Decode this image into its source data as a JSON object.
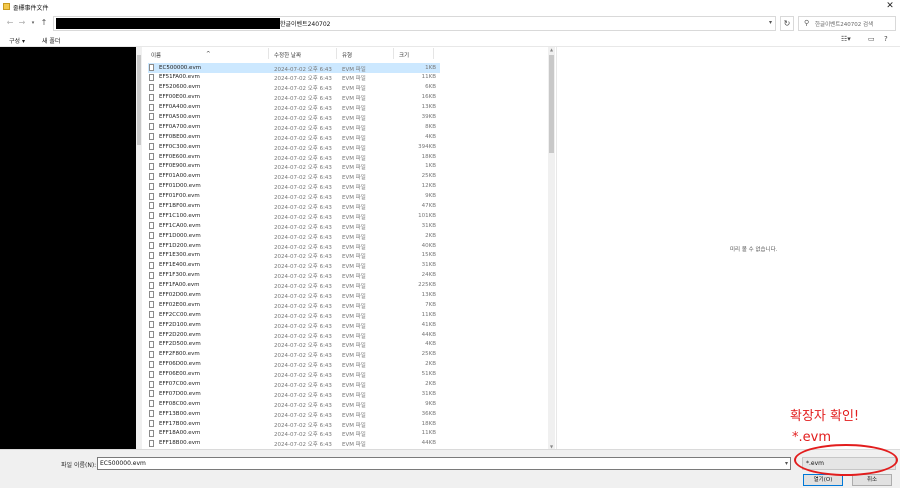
{
  "window": {
    "title": "줄標事件文件"
  },
  "address": {
    "current_folder": "한글이벤트240702",
    "chevron": "›",
    "dropdown": "▾"
  },
  "search": {
    "placeholder": "한글이벤트240702 검색"
  },
  "toolbar": {
    "organize": "구성 ▾",
    "new_folder": "새 폴더"
  },
  "columns": {
    "name": "이름",
    "date": "수정한 날짜",
    "type": "유형",
    "size": "크기"
  },
  "files": [
    {
      "name": "EC500000.evm",
      "date": "2024-07-02 오후 6:43",
      "type": "EVM 파일",
      "size": "1KB"
    },
    {
      "name": "EF51FA00.evm",
      "date": "2024-07-02 오후 6:43",
      "type": "EVM 파일",
      "size": "11KB"
    },
    {
      "name": "EF520600.evm",
      "date": "2024-07-02 오후 6:43",
      "type": "EVM 파일",
      "size": "6KB"
    },
    {
      "name": "EFF00E00.evm",
      "date": "2024-07-02 오후 6:43",
      "type": "EVM 파일",
      "size": "16KB"
    },
    {
      "name": "EFF0A400.evm",
      "date": "2024-07-02 오후 6:43",
      "type": "EVM 파일",
      "size": "13KB"
    },
    {
      "name": "EFF0A500.evm",
      "date": "2024-07-02 오후 6:43",
      "type": "EVM 파일",
      "size": "39KB"
    },
    {
      "name": "EFF0A700.evm",
      "date": "2024-07-02 오후 6:43",
      "type": "EVM 파일",
      "size": "8KB"
    },
    {
      "name": "EFF0BE00.evm",
      "date": "2024-07-02 오후 6:43",
      "type": "EVM 파일",
      "size": "4KB"
    },
    {
      "name": "EFF0C300.evm",
      "date": "2024-07-02 오후 6:43",
      "type": "EVM 파일",
      "size": "394KB"
    },
    {
      "name": "EFF0E600.evm",
      "date": "2024-07-02 오후 6:43",
      "type": "EVM 파일",
      "size": "18KB"
    },
    {
      "name": "EFF0E900.evm",
      "date": "2024-07-02 오후 6:43",
      "type": "EVM 파일",
      "size": "1KB"
    },
    {
      "name": "EFF01A00.evm",
      "date": "2024-07-02 오후 6:43",
      "type": "EVM 파일",
      "size": "25KB"
    },
    {
      "name": "EFF01D00.evm",
      "date": "2024-07-02 오후 6:43",
      "type": "EVM 파일",
      "size": "12KB"
    },
    {
      "name": "EFF01F00.evm",
      "date": "2024-07-02 오후 6:43",
      "type": "EVM 파일",
      "size": "9KB"
    },
    {
      "name": "EFF1BF00.evm",
      "date": "2024-07-02 오후 6:43",
      "type": "EVM 파일",
      "size": "47KB"
    },
    {
      "name": "EFF1C100.evm",
      "date": "2024-07-02 오후 6:43",
      "type": "EVM 파일",
      "size": "101KB"
    },
    {
      "name": "EFF1CA00.evm",
      "date": "2024-07-02 오후 6:43",
      "type": "EVM 파일",
      "size": "31KB"
    },
    {
      "name": "EFF1D000.evm",
      "date": "2024-07-02 오후 6:43",
      "type": "EVM 파일",
      "size": "2KB"
    },
    {
      "name": "EFF1D200.evm",
      "date": "2024-07-02 오후 6:43",
      "type": "EVM 파일",
      "size": "40KB"
    },
    {
      "name": "EFF1E300.evm",
      "date": "2024-07-02 오후 6:43",
      "type": "EVM 파일",
      "size": "15KB"
    },
    {
      "name": "EFF1E400.evm",
      "date": "2024-07-02 오후 6:43",
      "type": "EVM 파일",
      "size": "31KB"
    },
    {
      "name": "EFF1F300.evm",
      "date": "2024-07-02 오후 6:43",
      "type": "EVM 파일",
      "size": "24KB"
    },
    {
      "name": "EFF1FA00.evm",
      "date": "2024-07-02 오후 6:43",
      "type": "EVM 파일",
      "size": "225KB"
    },
    {
      "name": "EFF02D00.evm",
      "date": "2024-07-02 오후 6:43",
      "type": "EVM 파일",
      "size": "13KB"
    },
    {
      "name": "EFF02E00.evm",
      "date": "2024-07-02 오후 6:43",
      "type": "EVM 파일",
      "size": "7KB"
    },
    {
      "name": "EFF2CC00.evm",
      "date": "2024-07-02 오후 6:43",
      "type": "EVM 파일",
      "size": "11KB"
    },
    {
      "name": "EFF2D100.evm",
      "date": "2024-07-02 오후 6:43",
      "type": "EVM 파일",
      "size": "41KB"
    },
    {
      "name": "EFF2D200.evm",
      "date": "2024-07-02 오후 6:43",
      "type": "EVM 파일",
      "size": "44KB"
    },
    {
      "name": "EFF2D500.evm",
      "date": "2024-07-02 오후 6:43",
      "type": "EVM 파일",
      "size": "4KB"
    },
    {
      "name": "EFF2F800.evm",
      "date": "2024-07-02 오후 6:43",
      "type": "EVM 파일",
      "size": "25KB"
    },
    {
      "name": "EFF06D00.evm",
      "date": "2024-07-02 오후 6:43",
      "type": "EVM 파일",
      "size": "2KB"
    },
    {
      "name": "EFF06E00.evm",
      "date": "2024-07-02 오후 6:43",
      "type": "EVM 파일",
      "size": "51KB"
    },
    {
      "name": "EFF07C00.evm",
      "date": "2024-07-02 오후 6:43",
      "type": "EVM 파일",
      "size": "2KB"
    },
    {
      "name": "EFF07D00.evm",
      "date": "2024-07-02 오후 6:43",
      "type": "EVM 파일",
      "size": "31KB"
    },
    {
      "name": "EFF08C00.evm",
      "date": "2024-07-02 오후 6:43",
      "type": "EVM 파일",
      "size": "9KB"
    },
    {
      "name": "EFF13B00.evm",
      "date": "2024-07-02 오후 6:43",
      "type": "EVM 파일",
      "size": "36KB"
    },
    {
      "name": "EFF17B00.evm",
      "date": "2024-07-02 오후 6:43",
      "type": "EVM 파일",
      "size": "18KB"
    },
    {
      "name": "EFF18A00.evm",
      "date": "2024-07-02 오후 6:43",
      "type": "EVM 파일",
      "size": "11KB"
    },
    {
      "name": "EFF18B00.evm",
      "date": "2024-07-02 오후 6:43",
      "type": "EVM 파일",
      "size": "44KB"
    }
  ],
  "preview": {
    "message": "미리 볼 수 없습니다."
  },
  "annotations": {
    "line1": "확장자 확인!",
    "line2": "*.evm"
  },
  "bottom": {
    "filename_label": "파일 이름(N):",
    "filename_value": "EC500000.evm",
    "filter_value": "*.evm",
    "open_button": "열기(O)",
    "cancel_button": "취소"
  },
  "colors": {
    "selection": "#cce8ff",
    "annotation": "#e21d1d",
    "accent": "#0078d7"
  }
}
